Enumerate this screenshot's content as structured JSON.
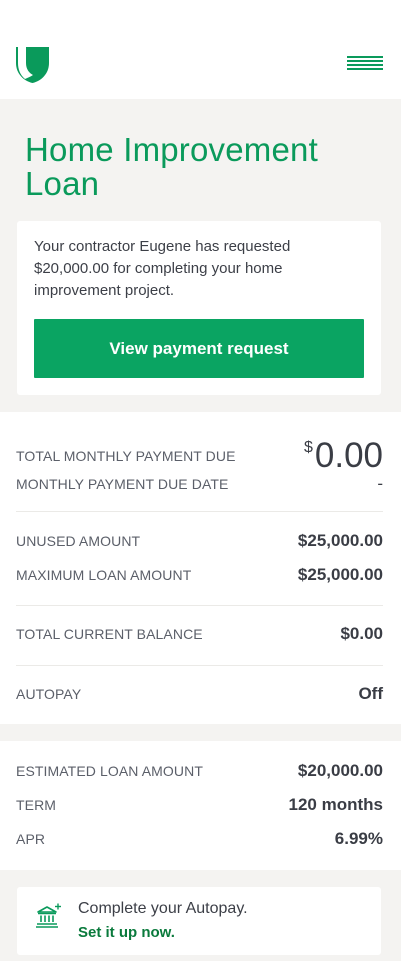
{
  "header": {
    "logo_icon": "shield-logo-icon",
    "menu_icon": "hamburger-menu-icon"
  },
  "title": "Home Improvement Loan",
  "request": {
    "text": "Your contractor Eugene has requested $20,000.00 for completing your home improvement project.",
    "button_label": "View payment request"
  },
  "summary": {
    "total_monthly_payment_label": "TOTAL MONTHLY PAYMENT DUE",
    "total_monthly_payment_currency": "$",
    "total_monthly_payment_value": "0.00",
    "due_date_label": "MONTHLY PAYMENT DUE DATE",
    "due_date_value": "-",
    "unused_label": "UNUSED AMOUNT",
    "unused_value": "$25,000.00",
    "max_label": "MAXIMUM LOAN AMOUNT",
    "max_value": "$25,000.00",
    "balance_label": "TOTAL CURRENT BALANCE",
    "balance_value": "$0.00",
    "autopay_label": "AUTOPAY",
    "autopay_value": "Off"
  },
  "estimate": {
    "amount_label": "ESTIMATED LOAN AMOUNT",
    "amount_value": "$20,000.00",
    "term_label": "TERM",
    "term_value": "120 months",
    "apr_label": "APR",
    "apr_value": "6.99%"
  },
  "autopay_card": {
    "icon": "bank-plus-icon",
    "text": "Complete your Autopay.",
    "link": "Set it up now."
  },
  "colors": {
    "brand_green": "#0a9a5b",
    "button_green": "#0aa462",
    "link_green": "#0a7a3c",
    "background": "#f4f3f1"
  }
}
